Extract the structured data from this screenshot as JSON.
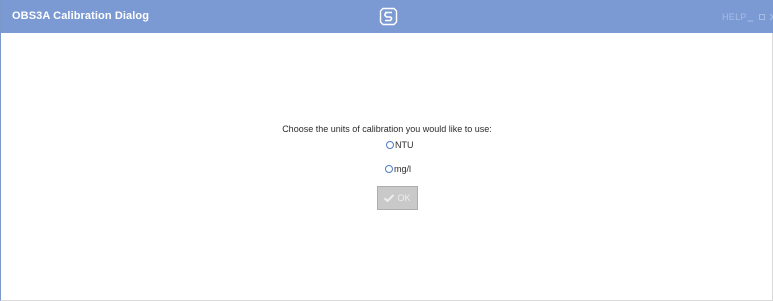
{
  "window": {
    "title": "OBS3A Calibration Dialog",
    "help_label": "HELP",
    "minimize_glyph": "_",
    "maximize_glyph": "▫",
    "colors": {
      "titlebar": "#7b9ad3",
      "titlebar_controls": "#a8bde4",
      "radio_border": "#4d7cc7",
      "button_disabled": "#c9c9c9"
    }
  },
  "dialog": {
    "prompt": "Choose the units of calibration you would like to use:",
    "options": [
      {
        "label": "NTU",
        "selected": false
      },
      {
        "label": "mg/l",
        "selected": false
      }
    ],
    "ok_button": {
      "label": "OK",
      "icon": "checkmark-icon",
      "enabled": false
    }
  },
  "icons": {
    "logo": "campbell-scientific-logo-icon",
    "close": "close-icon"
  }
}
